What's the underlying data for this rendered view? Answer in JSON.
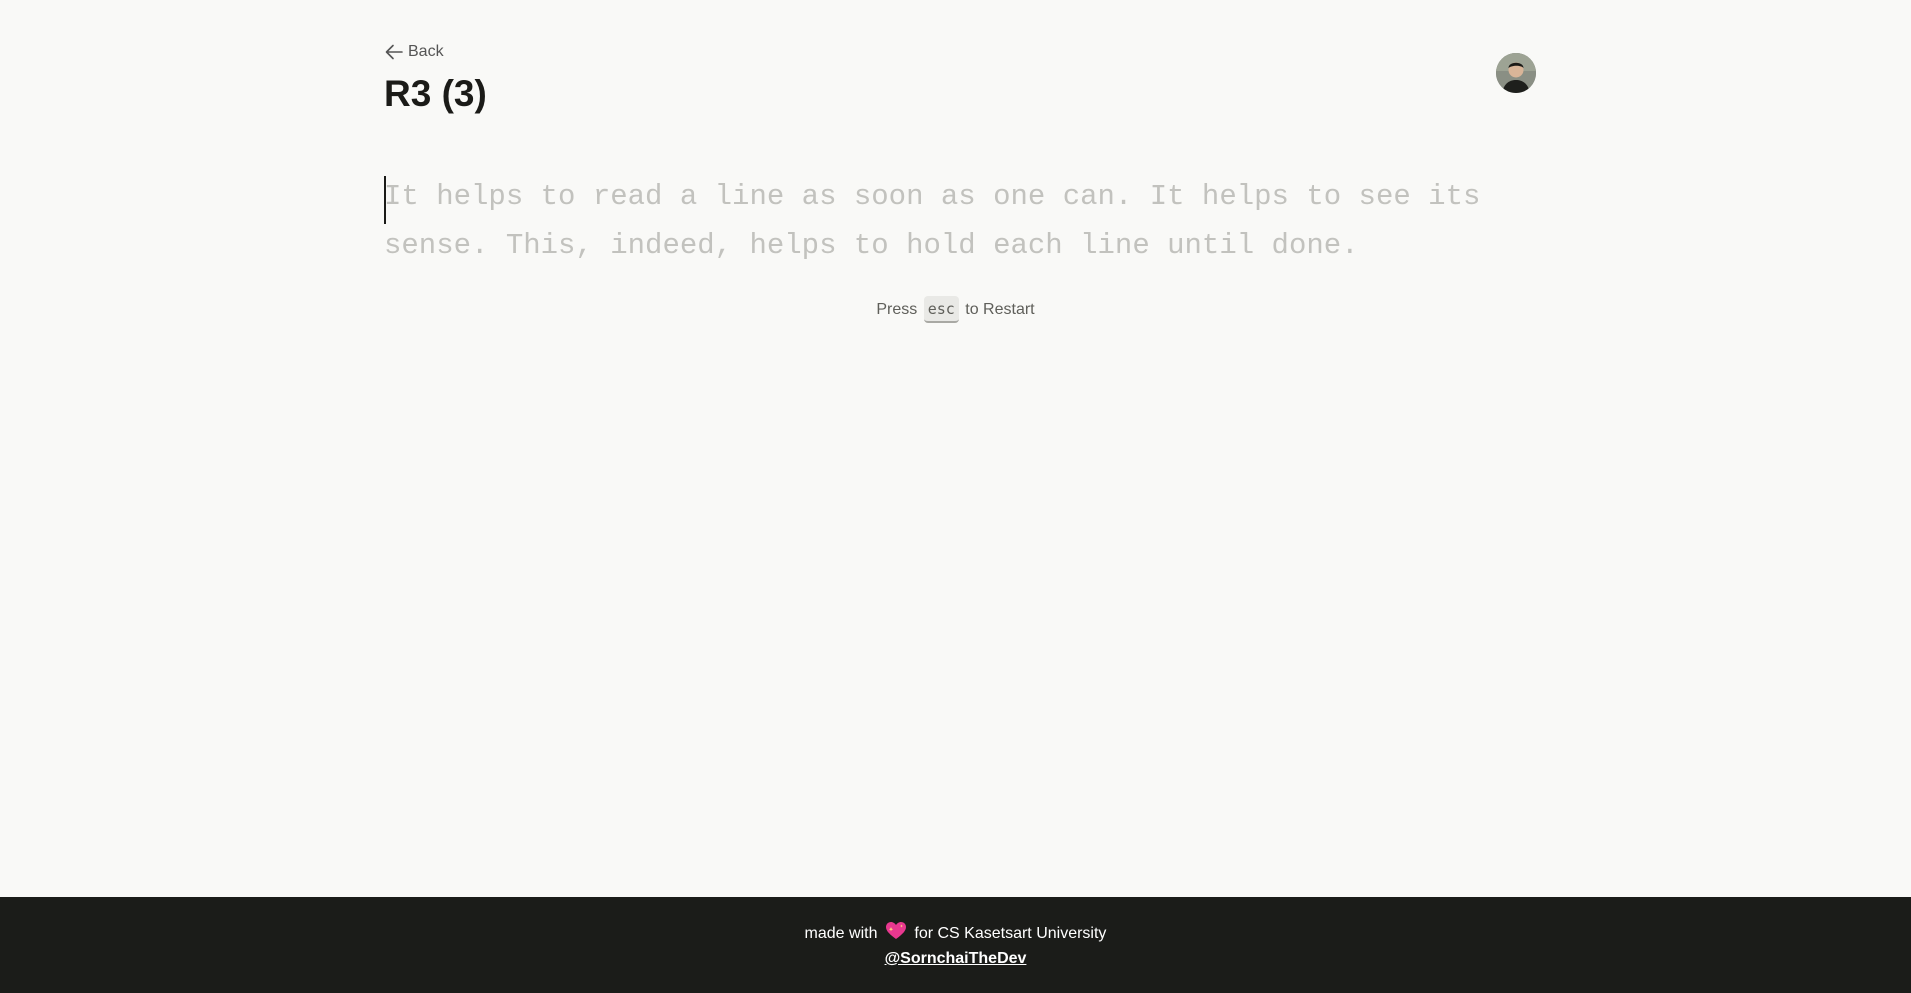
{
  "header": {
    "back_label": "Back",
    "title": "R3 (3)",
    "back_icon": "arrow-left-icon",
    "avatar_icon": "user-avatar"
  },
  "typing": {
    "text": "It helps to read a line as soon as one can. It helps to see its sense. This, indeed, helps to hold each line until done.",
    "pending_color": "#c2c2be",
    "caret_color": "#1b1b18"
  },
  "hint": {
    "prefix": "Press",
    "key": "esc",
    "suffix": "to Restart"
  },
  "footer": {
    "made_with": "made with",
    "heart_icon": "sparkling-heart-icon",
    "for_text": "for CS Kasetsart University",
    "handle": "@SornchaiTheDev",
    "background": "#1b1c19"
  },
  "colors": {
    "page_background": "#f9f9f7",
    "title": "#1b1b18",
    "heart": "#e8388f"
  }
}
